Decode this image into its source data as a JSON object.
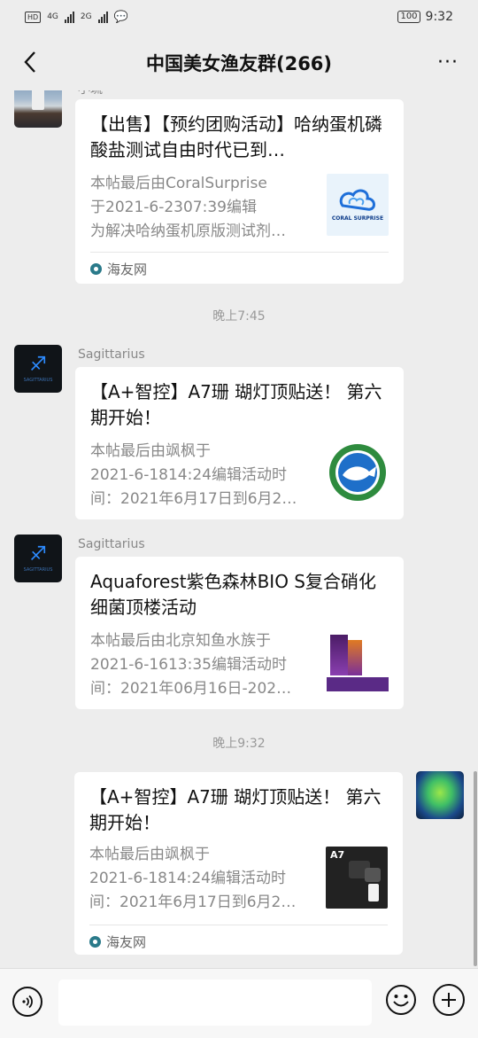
{
  "status": {
    "badge_hd": "HD",
    "net1": "4G",
    "net2": "2G",
    "battery": "100",
    "time": "9:32"
  },
  "header": {
    "title": "中国美女渔友群(266)",
    "more": "···"
  },
  "messages": [
    {
      "sender": "小琉",
      "title": "【出售】【预约团购活动】哈纳蛋机磷酸盐测试自由时代已到…",
      "desc": [
        "本帖最后由CoralSurprise",
        "于2021-6-2307:39编辑",
        "为解决哈纳蛋机原版测试剂…"
      ],
      "thumb_text": "CORAL SURPRISE",
      "source": "海友网"
    },
    {
      "sender": "Sagittarius",
      "title": "【A+智控】A7珊 瑚灯顶贴送！ 第六期开始！",
      "desc": [
        "本帖最后由飒枫于",
        "2021-6-1814:24编辑活动时",
        "间：2021年6月17日到6月2…"
      ]
    },
    {
      "sender": "Sagittarius",
      "title": "Aquaforest紫色森林BIO S复合硝化细菌顶楼活动",
      "desc": [
        "本帖最后由北京知鱼水族于",
        "2021-6-1613:35编辑活动时",
        "间：2021年06月16日-202…"
      ]
    },
    {
      "title": "【A+智控】A7珊 瑚灯顶贴送！ 第六期开始！",
      "desc": [
        "本帖最后由飒枫于",
        "2021-6-1814:24编辑活动时",
        "间：2021年6月17日到6月2…"
      ],
      "thumb_text": "A7",
      "source": "海友网"
    }
  ],
  "timestamps": [
    "晚上7:45",
    "晚上9:32"
  ],
  "avatar_small_text": "SAGITTARIUS",
  "colors": {
    "background": "#ededed",
    "card": "#ffffff",
    "accent_blue": "#2d8bff"
  }
}
